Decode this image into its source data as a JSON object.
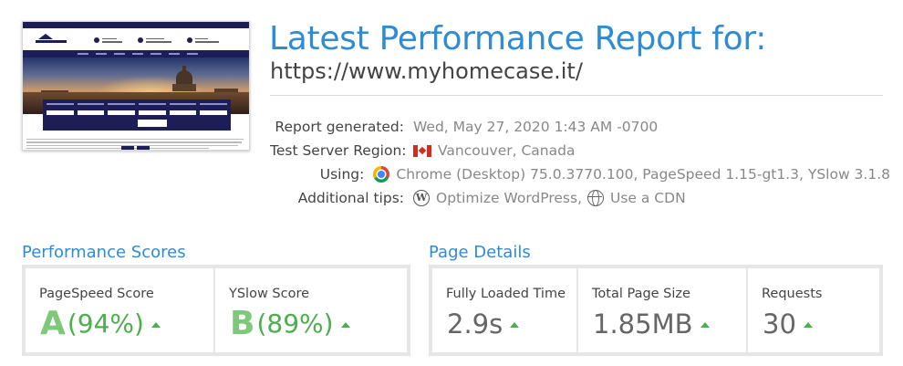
{
  "report": {
    "title": "Latest Performance Report for:",
    "url": "https://www.myhomecase.it/"
  },
  "info": [
    {
      "label": "Report generated:",
      "value": "Wed, May 27, 2020 1:43 AM -0700",
      "icon": ""
    },
    {
      "label": "Test Server Region:",
      "value": "Vancouver, Canada",
      "icon": "canada-flag-icon"
    },
    {
      "label": "Using:",
      "value": "Chrome (Desktop) 75.0.3770.100, PageSpeed 1.15-gt1.3, YSlow 3.1.8",
      "icon": "chrome-icon"
    },
    {
      "label": "Additional tips:",
      "tips": [
        {
          "text": "Optimize WordPress",
          "icon": "wordpress-icon"
        },
        {
          "text": "Use a CDN",
          "icon": "globe-icon"
        }
      ],
      "separator": ","
    }
  ],
  "performance": {
    "heading": "Performance Scores",
    "pagespeed": {
      "label": "PageSpeed Score",
      "grade": "A",
      "percent": "(94%)"
    },
    "yslow": {
      "label": "YSlow Score",
      "grade": "B",
      "percent": "(89%)"
    }
  },
  "details": {
    "heading": "Page Details",
    "load_time": {
      "label": "Fully Loaded Time",
      "value": "2.9s"
    },
    "page_size": {
      "label": "Total Page Size",
      "value": "1.85MB"
    },
    "requests": {
      "label": "Requests",
      "value": "30"
    }
  },
  "colors": {
    "accent": "#2f8bd4",
    "grade_a": "#7ec87a",
    "good": "#4cae4c",
    "site_brand": "#1d1e57"
  }
}
